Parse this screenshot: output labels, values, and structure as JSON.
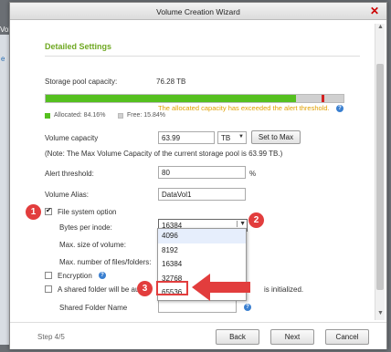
{
  "background": {
    "text1": "Volu",
    "text2": "e"
  },
  "window": {
    "title": "Volume Creation Wizard",
    "close": "✕"
  },
  "section": {
    "title": "Detailed Settings"
  },
  "capacity": {
    "label": "Storage pool capacity:",
    "value": "76.28 TB",
    "allocated_percent": 84.16,
    "allocated_label": "Allocated: 84.16%",
    "free_label": "Free: 15.84%",
    "warning": "The allocated capacity has exceeded the alert threshold."
  },
  "volume_capacity": {
    "label": "Volume capacity",
    "value": "63.99",
    "unit": "TB",
    "set_max_button": "Set to Max",
    "note": "(Note: The Max Volume Capacity of the current storage pool is 63.99 TB.)"
  },
  "alert_threshold": {
    "label": "Alert threshold:",
    "value": "80",
    "unit": "%"
  },
  "volume_alias": {
    "label": "Volume Alias:",
    "value": "DataVol1"
  },
  "fs_option": {
    "label": "File system option",
    "checked": true,
    "bytes_per_inode_label": "Bytes per inode:",
    "bytes_per_inode_value": "16384",
    "max_size_label": "Max. size of volume:",
    "max_files_label": "Max. number of files/folders:",
    "options": [
      "4096",
      "8192",
      "16384",
      "32768",
      "65536"
    ]
  },
  "encryption": {
    "label": "Encryption",
    "checked": false
  },
  "shared_folder": {
    "label_left": "A shared folder will be au",
    "label_right": "is initialized.",
    "name_label": "Shared Folder Name",
    "checked": false
  },
  "annotations": {
    "badge1": "1",
    "badge2": "2",
    "badge3": "3"
  },
  "footer": {
    "step": "Step 4/5",
    "back": "Back",
    "next": "Next",
    "cancel": "Cancel"
  },
  "colors": {
    "accent": "#6fa822",
    "bar_allocated": "#55c01f",
    "bar_free": "#d0d0d0",
    "marker": "#d42020",
    "warning": "#e0a000",
    "annotation": "#e23d3d"
  }
}
